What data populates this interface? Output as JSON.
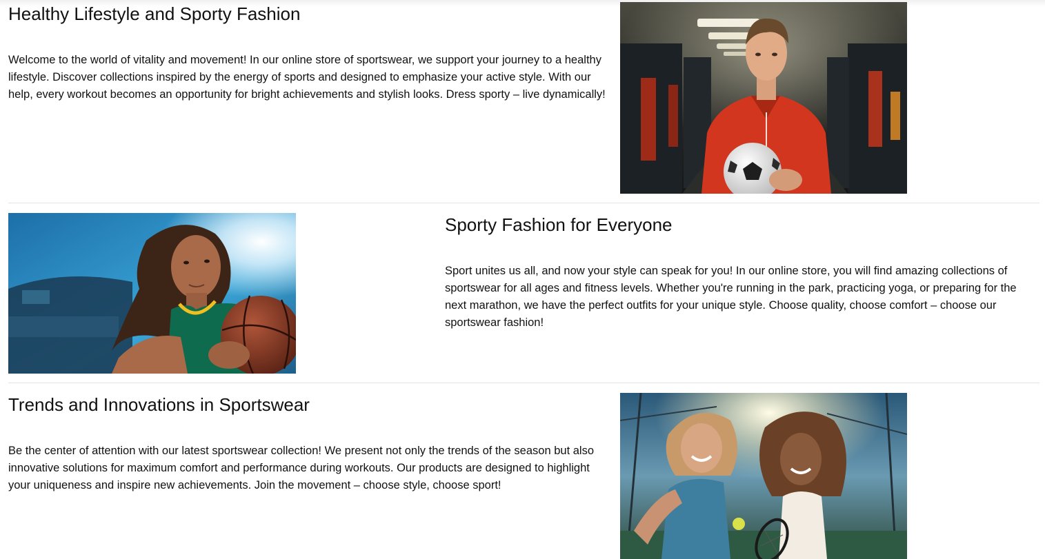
{
  "sections": [
    {
      "title": "Healthy Lifestyle and Sporty Fashion",
      "text": "Welcome to the world of vitality and movement! In our online store of sportswear, we support your journey to a healthy lifestyle. Discover collections inspired by the energy of sports and designed to emphasize your active style. With our help, every workout becomes an opportunity for bright achievements and stylish looks. Dress sporty – live dynamically!",
      "image": "man-red-hoodie-soccer-ball-photo"
    },
    {
      "title": "Sporty Fashion for Everyone",
      "text": "Sport unites us all, and now your style can speak for you! In our online store, you will find amazing collections of sportswear for all ages and fitness levels. Whether you're running in the park, practicing yoga, or preparing for the next marathon, we have the perfect outfits for your unique style. Choose quality, choose comfort – choose our sportswear fashion!",
      "image": "woman-basketball-player-photo"
    },
    {
      "title": "Trends and Innovations in Sportswear",
      "text": "Be the center of attention with our latest sportswear collection! We present not only the trends of the season but also innovative solutions for maximum comfort and performance during workouts. Our products are designed to highlight your uniqueness and inspire new achievements. Join the movement – choose style, choose sport!",
      "image": "girls-tennis-court-photo"
    }
  ],
  "colors": {
    "text": "#111111",
    "divider": "#e3e3e3",
    "background": "#ffffff"
  }
}
